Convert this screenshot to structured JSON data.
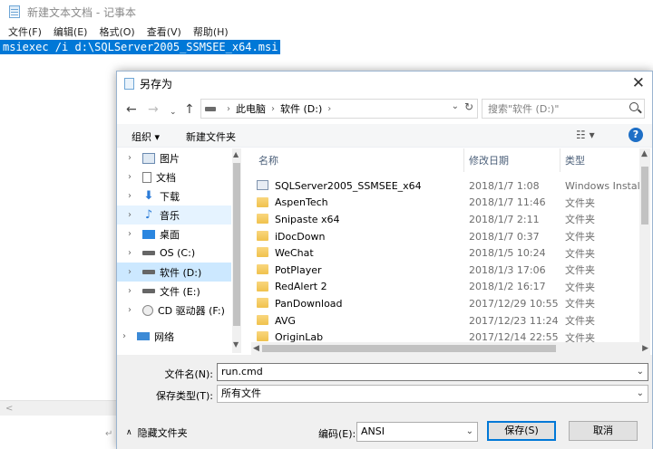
{
  "notepad": {
    "title": "新建文本文档 - 记事本",
    "menus": [
      "文件(F)",
      "编辑(E)",
      "格式(O)",
      "查看(V)",
      "帮助(H)"
    ],
    "content": "msiexec /i d:\\SQLServer2005_SSMSEE_x64.msi"
  },
  "dialog": {
    "title": "另存为",
    "address_parts": [
      "此电脑",
      "软件 (D:)"
    ],
    "search_placeholder": "搜索\"软件 (D:)\"",
    "toolbar": {
      "organize": "组织 ▾",
      "new_folder": "新建文件夹",
      "view": "☷ ▾"
    },
    "sidebar": [
      {
        "label": "图片",
        "icon": "pictures-icon"
      },
      {
        "label": "文档",
        "icon": "documents-icon"
      },
      {
        "label": "下载",
        "icon": "downloads-icon"
      },
      {
        "label": "音乐",
        "icon": "music-icon"
      },
      {
        "label": "桌面",
        "icon": "desktop-icon"
      },
      {
        "label": "OS (C:)",
        "icon": "drive-icon"
      },
      {
        "label": "软件 (D:)",
        "icon": "drive-icon",
        "selected": true
      },
      {
        "label": "文件 (E:)",
        "icon": "drive-icon"
      },
      {
        "label": "CD 驱动器 (F:)",
        "icon": "cd-drive-icon"
      },
      {
        "label": "网络",
        "icon": "network-icon"
      }
    ],
    "columns": {
      "name": "名称",
      "date": "修改日期",
      "type": "类型"
    },
    "files": [
      {
        "name": "SQLServer2005_SSMSEE_x64",
        "date": "2018/1/7 1:08",
        "type": "Windows Install",
        "kind": "msi"
      },
      {
        "name": "AspenTech",
        "date": "2018/1/7 11:46",
        "type": "文件夹",
        "kind": "folder"
      },
      {
        "name": "Snipaste x64",
        "date": "2018/1/7 2:11",
        "type": "文件夹",
        "kind": "folder"
      },
      {
        "name": "iDocDown",
        "date": "2018/1/7 0:37",
        "type": "文件夹",
        "kind": "folder"
      },
      {
        "name": "WeChat",
        "date": "2018/1/5 10:24",
        "type": "文件夹",
        "kind": "folder"
      },
      {
        "name": "PotPlayer",
        "date": "2018/1/3 17:06",
        "type": "文件夹",
        "kind": "folder"
      },
      {
        "name": "RedAlert 2",
        "date": "2018/1/2 16:17",
        "type": "文件夹",
        "kind": "folder"
      },
      {
        "name": "PanDownload",
        "date": "2017/12/29 10:55",
        "type": "文件夹",
        "kind": "folder"
      },
      {
        "name": "AVG",
        "date": "2017/12/23 11:24",
        "type": "文件夹",
        "kind": "folder"
      },
      {
        "name": "OriginLab",
        "date": "2017/12/14 22:55",
        "type": "文件夹",
        "kind": "folder"
      }
    ],
    "filename_label": "文件名(N):",
    "filename_value": "run.cmd",
    "filetype_label": "保存类型(T):",
    "filetype_value": "所有文件",
    "hide_folders": "隐藏文件夹",
    "encoding_label": "编码(E):",
    "encoding_value": "ANSI",
    "save_button": "保存(S)",
    "cancel_button": "取消"
  }
}
